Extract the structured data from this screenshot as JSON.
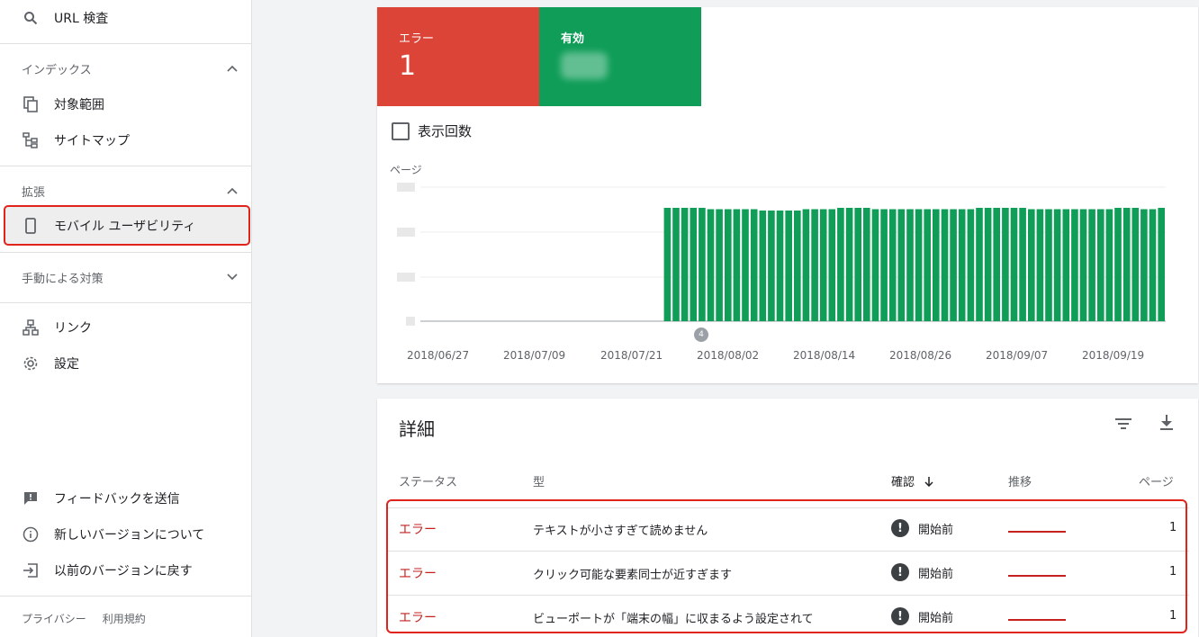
{
  "sidebar": {
    "url_inspection": "URL 検査",
    "index_heading": "インデックス",
    "coverage": "対象範囲",
    "sitemaps": "サイトマップ",
    "enhancements_heading": "拡張",
    "mobile_usability": "モバイル ユーザビリティ",
    "manual_actions_heading": "手動による対策",
    "links": "リンク",
    "settings": "設定",
    "send_feedback": "フィードバックを送信",
    "about_new_version": "新しいバージョンについて",
    "previous_version": "以前のバージョンに戻す",
    "privacy": "プライバシー",
    "terms": "利用規約"
  },
  "summary": {
    "error_label": "エラー",
    "error_count": "1",
    "valid_label": "有効",
    "error_color": "#db4437",
    "valid_color": "#0f9d58"
  },
  "chart_controls": {
    "impressions_label": "表示回数"
  },
  "chart_data": {
    "type": "bar",
    "ylabel": "ページ",
    "x_tick_labels": [
      "2018/06/27",
      "2018/07/09",
      "2018/07/21",
      "2018/08/02",
      "2018/08/14",
      "2018/08/26",
      "2018/09/07",
      "2018/09/19"
    ],
    "annotation_marker": "4",
    "series": [
      {
        "values": [
          0,
          0,
          0,
          0,
          0,
          0,
          0,
          0,
          0,
          0,
          0,
          0,
          0,
          0,
          0,
          0,
          0,
          0,
          0,
          0,
          0,
          0,
          0,
          0,
          0,
          0,
          0,
          0,
          0.84,
          0.84,
          0.84,
          0.84,
          0.84,
          0.83,
          0.83,
          0.83,
          0.83,
          0.83,
          0.83,
          0.82,
          0.82,
          0.82,
          0.82,
          0.82,
          0.83,
          0.83,
          0.83,
          0.83,
          0.84,
          0.84,
          0.84,
          0.84,
          0.83,
          0.83,
          0.83,
          0.83,
          0.83,
          0.83,
          0.83,
          0.83,
          0.83,
          0.83,
          0.83,
          0.83,
          0.84,
          0.84,
          0.84,
          0.84,
          0.84,
          0.84,
          0.83,
          0.83,
          0.83,
          0.83,
          0.83,
          0.83,
          0.83,
          0.83,
          0.83,
          0.83,
          0.84,
          0.84,
          0.84,
          0.83,
          0.83,
          0.84
        ]
      }
    ]
  },
  "details": {
    "title": "詳細",
    "columns": {
      "status": "ステータス",
      "type": "型",
      "validation": "確認",
      "trend": "推移",
      "pages": "ページ"
    },
    "rows": [
      {
        "status": "エラー",
        "type": "テキストが小さすぎて読めません",
        "validation": "開始前",
        "pages": "1"
      },
      {
        "status": "エラー",
        "type": "クリック可能な要素同士が近すぎます",
        "validation": "開始前",
        "pages": "1"
      },
      {
        "status": "エラー",
        "type": "ビューポートが「端末の幅」に収まるよう設定されて",
        "validation": "開始前",
        "pages": "1"
      }
    ]
  }
}
